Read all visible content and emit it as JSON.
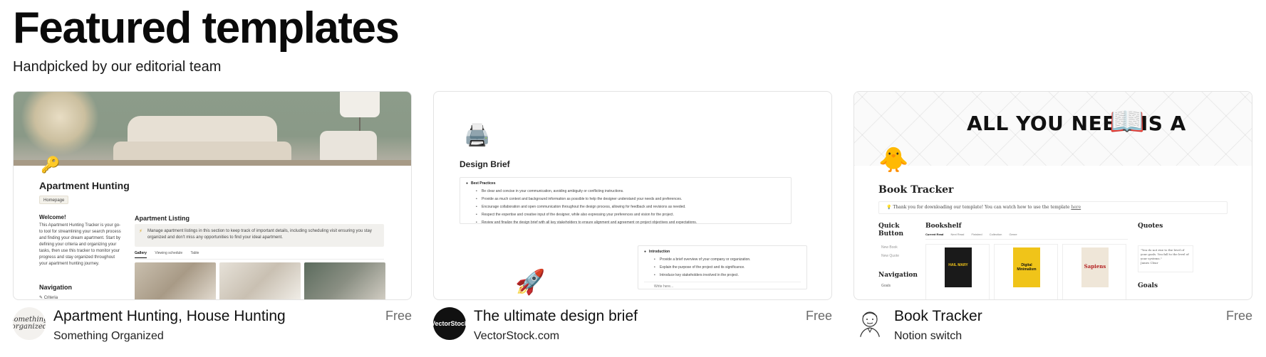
{
  "header": {
    "title": "Featured templates",
    "subtitle": "Handpicked by our editorial team"
  },
  "cards": [
    {
      "title": "Apartment Hunting, House Hunting",
      "author": "Something Organized",
      "price": "Free",
      "logo_text": "something organized",
      "preview": {
        "page_title": "Apartment Hunting",
        "chip": "Homepage",
        "welcome": "Welcome!",
        "description": "This Apartment Hunting Tracker is your go-to tool for streamlining your search process and finding your dream apartment. Start by defining your criteria and organizing your tasks, then use this tracker to monitor your progress and stay organized throughout your apartment hunting journey.",
        "nav_heading": "Navigation",
        "nav_item": "Criteria",
        "listing_heading": "Apartment Listing",
        "callout": "Manage apartment listings in this section to keep track of important details, including scheduling visit ensuring you stay organized and don't miss any opportunities to find your ideal apartment.",
        "tabs": [
          "Gallery",
          "Viewing schedule",
          "Table"
        ]
      }
    },
    {
      "title": "The ultimate design brief",
      "author": "VectorStock.com",
      "price": "Free",
      "logo_text": "VectorStock",
      "preview": {
        "page_title": "Design Brief",
        "best_practices_heading": "Best Practices",
        "best_practices": [
          "Be clear and concise in your communication, avoiding ambiguity or conflicting instructions.",
          "Provide as much context and background information as possible to help the designer understand your needs and preferences.",
          "Encourage collaboration and open communication throughout the design process, allowing for feedback and revisions as needed.",
          "Respect the expertise and creative input of the designer, while also expressing your preferences and vision for the project.",
          "Review and finalize the design brief with all key stakeholders to ensure alignment and agreement on project objectives and expectations."
        ],
        "intro_heading": "Introduction",
        "intro_items": [
          "Provide a brief overview of your company or organization.",
          "Explain the purpose of the project and its significance.",
          "Introduce key stakeholders involved in the project."
        ],
        "write_here": "Write here..."
      }
    },
    {
      "title": "Book Tracker",
      "author": "Notion switch",
      "price": "Free",
      "preview": {
        "banner": "ALL YOU NEED IS A",
        "page_title": "Book Tracker",
        "callout": "Thank you for downloading our template! You can watch how to use the template",
        "callout_link": "here",
        "quick_button": "Quick Button",
        "quick_items": [
          "New Book",
          "New Quote"
        ],
        "nav_heading": "Navigation",
        "nav_item": "Goals",
        "bookshelf_heading": "Bookshelf",
        "bookshelf_tabs": [
          "Current Read",
          "Next Read",
          "Finished",
          "Collection",
          "Genre"
        ],
        "books": [
          "HAIL MARY",
          "Digital Minimalism",
          "Sapiens"
        ],
        "quotes_heading": "Quotes",
        "quote": "\"You do not rise to the level of your goals. You fall to the level of your systems.\"",
        "quote_author": "James Clear",
        "goals_heading": "Goals"
      }
    }
  ]
}
